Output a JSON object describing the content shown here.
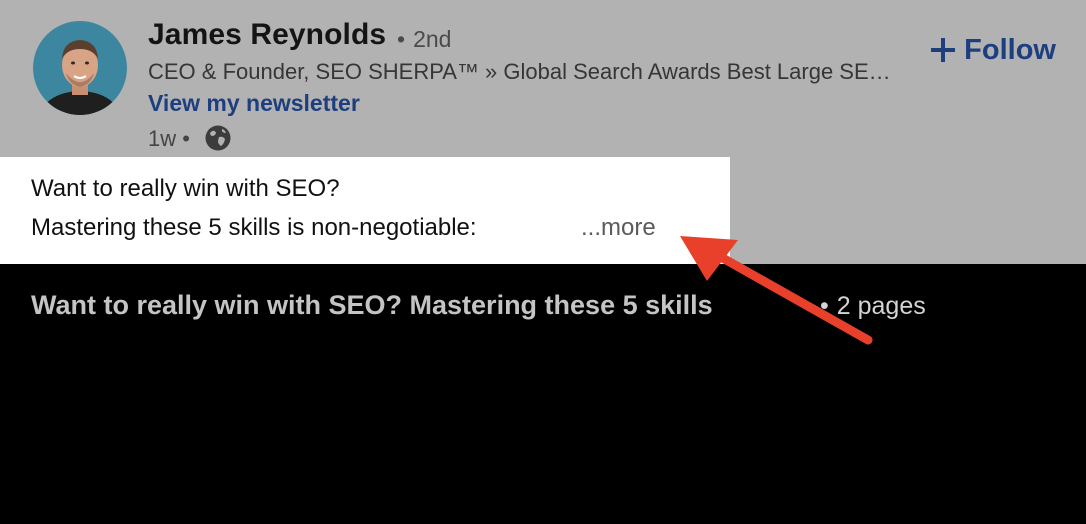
{
  "author": {
    "name": "James Reynolds",
    "degree_separator": "•",
    "degree": "2nd",
    "headline": "CEO & Founder, SEO SHERPA™ » Global Search Awards Best Large SEO Agency",
    "newsletter_link": "View my newsletter",
    "timestamp": "1w",
    "timestamp_separator": "•",
    "visibility_icon": "globe-icon"
  },
  "follow": {
    "icon": "plus-icon",
    "label": "Follow"
  },
  "post": {
    "line1": "Want to really win with SEO?",
    "line2": "Mastering these 5 skills is non-negotiable:",
    "see_more": "...more"
  },
  "document": {
    "title": "Want to really win with SEO? Mastering these 5 skills",
    "separator": "•",
    "pages": "2 pages"
  },
  "annotation": {
    "type": "arrow",
    "color": "#e8402b"
  },
  "colors": {
    "header_overlay": "#b2b2b2",
    "link_blue": "#1d3f80",
    "background": "#000000"
  }
}
